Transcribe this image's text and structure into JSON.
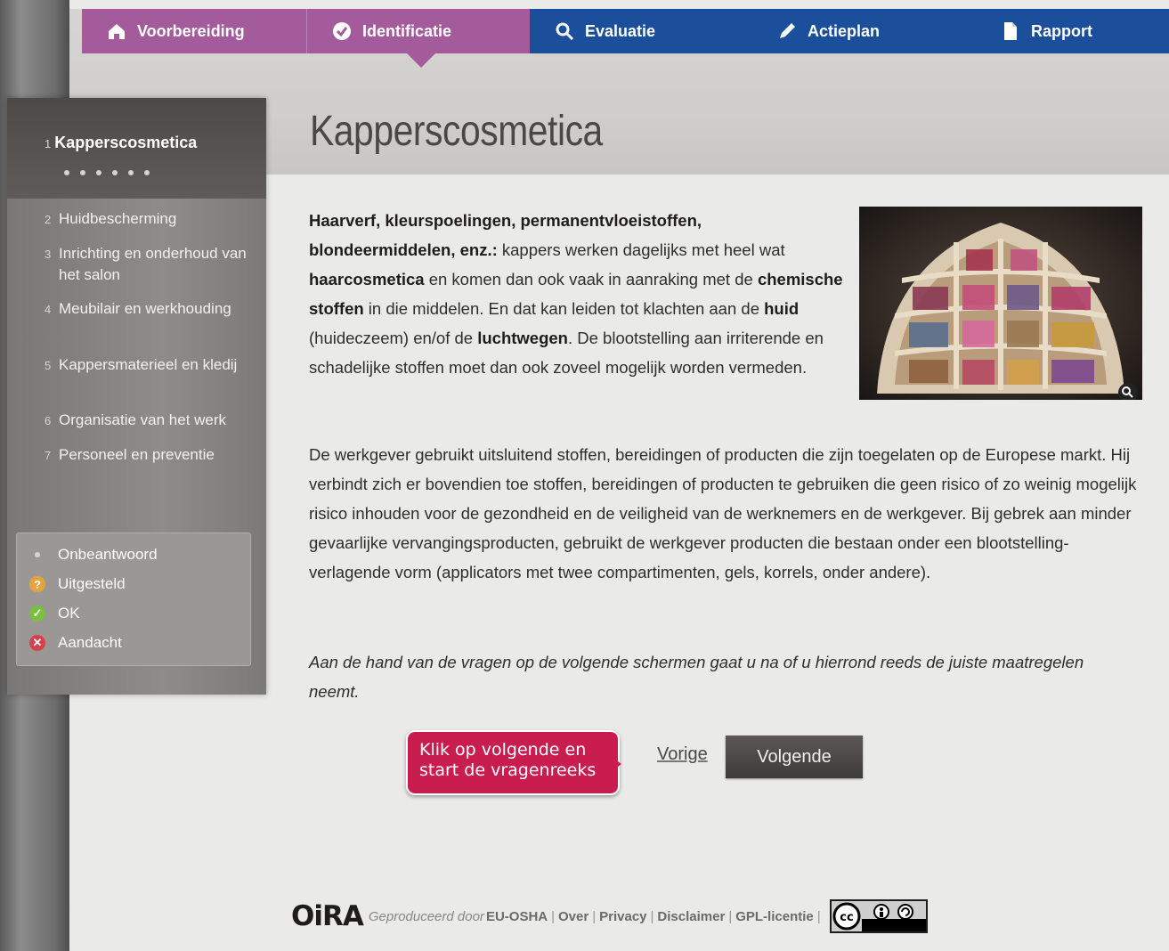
{
  "tabs": {
    "prep": "Voorbereiding",
    "ident": "Identificatie",
    "eval": "Evaluatie",
    "plan": "Actieplan",
    "report": "Rapport"
  },
  "sidebar": {
    "active": {
      "num": "1",
      "label": "Kapperscosmetica"
    },
    "items": [
      {
        "num": "2",
        "label": "Huidbescherming"
      },
      {
        "num": "3",
        "label": "Inrichting en onderhoud van het salon"
      },
      {
        "num": "4",
        "label": "Meubilair en werkhouding"
      },
      {
        "num": "5",
        "label": "Kappersmaterieel en kledij"
      },
      {
        "num": "6",
        "label": "Organisatie van het werk"
      },
      {
        "num": "7",
        "label": "Personeel en preventie"
      }
    ],
    "legend": {
      "unanswered": "Onbeantwoord",
      "postponed": "Uitgesteld",
      "ok": "OK",
      "attention": "Aandacht"
    }
  },
  "main": {
    "title": "Kapperscosmetica",
    "p1": {
      "s1": "Haarverf, kleurspoelingen, permanentvloeistoffen, blondeermiddelen, enz.:",
      "s2": " kappers werken dagelijks met heel wat ",
      "s3": "haarcosmetica",
      "s4": " en komen dan ook vaak in aanraking met de ",
      "s5": "chemische stoffen",
      "s6": " in die middelen. En dat kan leiden tot klachten aan de ",
      "s7": "huid",
      "s8": " (huideczeem) en/of de ",
      "s9": "luchtwegen",
      "s10": ". De blootstelling aan irriterende en schadelijke stoffen moet dan ook zoveel mogelijk worden vermeden."
    },
    "p2": "De werkgever gebruikt uitsluitend stoffen, bereidingen of producten die zijn toegelaten op de Europese markt. Hij verbindt zich er bovendien toe stoffen, bereidingen of producten te gebruiken die geen risico of zo weinig mogelijk risico inhouden voor de gezondheid en de veiligheid van de werknemers en de werkgever. Bij gebrek aan minder gevaarlijke vervangingsproducten, gebruikt de werkgever producten die bestaan onder een blootstelling-verlagende vorm (applicators met twee compartimenten, gels, korrels, onder andere).",
    "p3": "Aan de hand van de vragen op de volgende schermen gaat u na of u hierrond reeds de juiste maatregelen neemt.",
    "prev": "Vorige",
    "next": "Volgende",
    "callout": "Klik op volgende en start de vragenreeks"
  },
  "footer": {
    "logo": "OiRA",
    "produced": "Geproduceerd door ",
    "osha": "EU-OSHA",
    "links": [
      "Over",
      "Privacy",
      "Disclaimer",
      "GPL-licentie"
    ]
  },
  "colors": {
    "purple": "#a35b9c",
    "blue": "#1b4f9c",
    "callout": "#c91d4f"
  }
}
